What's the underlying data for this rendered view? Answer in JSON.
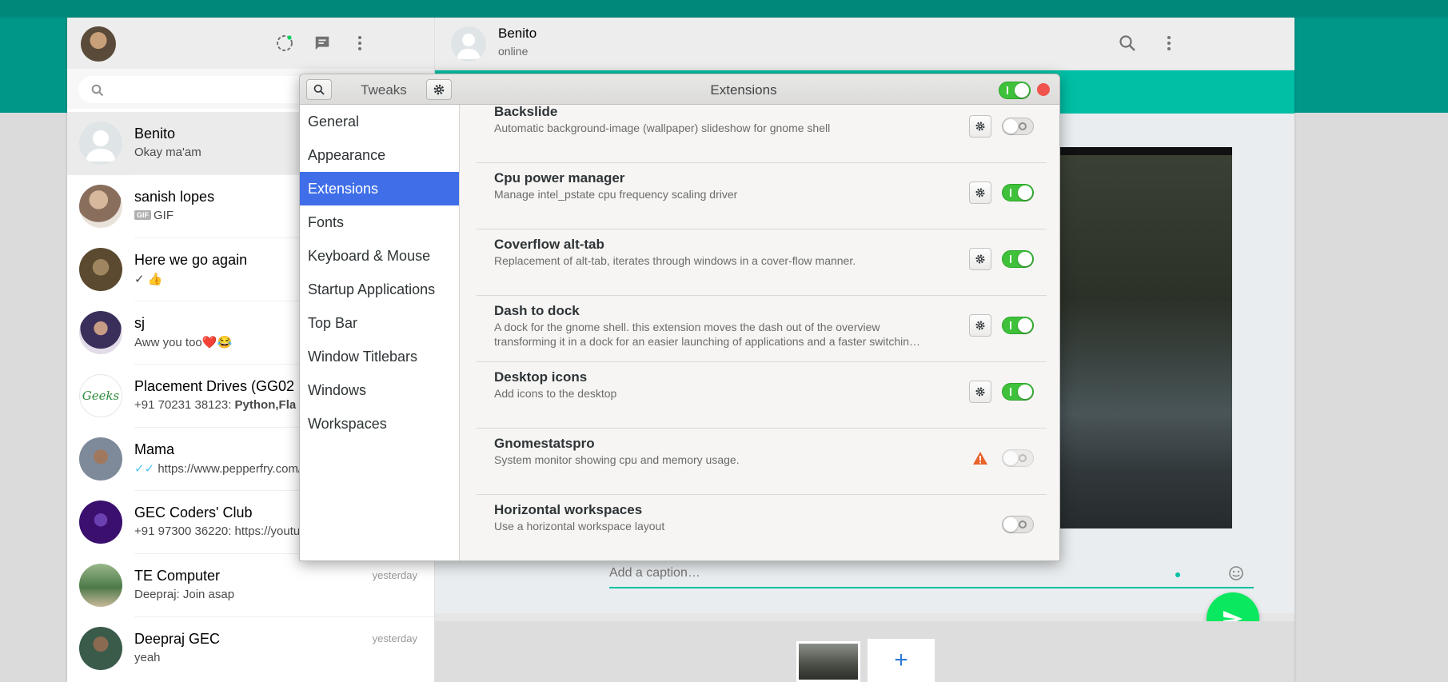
{
  "whatsapp": {
    "search": {
      "placeholder": ""
    },
    "chats": [
      {
        "name": "Benito",
        "message": "Okay ma'am",
        "time": "",
        "avatar_color": "#dfe5e7"
      },
      {
        "name": "sanish lopes",
        "gif_badge": "GIF",
        "message": "GIF",
        "time": "",
        "avatar_color": "#8a6e5c"
      },
      {
        "name": "Here we go again",
        "message": "✓ 👍",
        "time": "",
        "avatar_color": "#6b5a3e"
      },
      {
        "name": "sj",
        "message": "Aww you too❤️😂",
        "time": "",
        "avatar_color": "#3a2f5a"
      },
      {
        "name": "Placement Drives (GG02",
        "message_prefix": "+91 70231 38123: ",
        "message_bold": "Python,Fla",
        "time": "",
        "avatar_color": "#ffffff"
      },
      {
        "name": "Mama",
        "message": "https://www.pepperfry.com/",
        "time": "",
        "avatar_color": "#7e8a9a"
      },
      {
        "name": "GEC Coders' Club",
        "message": "+91 97300 36220: https://youtu",
        "time": "",
        "avatar_color": "#3a0f6e"
      },
      {
        "name": "TE Computer",
        "message": "Deepraj: Join asap",
        "time": "yesterday",
        "avatar_color": "#4d7a4a"
      },
      {
        "name": "Deepraj GEC",
        "message": "yeah",
        "time": "yesterday",
        "avatar_color": "#3a5a4a"
      }
    ],
    "contact": {
      "name": "Benito",
      "status": "online"
    },
    "caption": {
      "placeholder": "Add a caption…"
    },
    "add_media_label": "+"
  },
  "tweaks": {
    "search_title": "Tweaks",
    "page_title": "Extensions",
    "extensions_enabled": true,
    "sidebar": [
      "General",
      "Appearance",
      "Extensions",
      "Fonts",
      "Keyboard & Mouse",
      "Startup Applications",
      "Top Bar",
      "Window Titlebars",
      "Windows",
      "Workspaces"
    ],
    "selected_sidebar": "Extensions",
    "extensions": [
      {
        "name": "Backslide",
        "desc": "Automatic background-image (wallpaper) slideshow for gnome shell",
        "has_settings": true,
        "state": "off"
      },
      {
        "name": "Cpu power manager",
        "desc": "Manage intel_pstate cpu frequency scaling driver",
        "has_settings": true,
        "state": "on"
      },
      {
        "name": "Coverflow alt-tab",
        "desc": "Replacement of alt-tab, iterates through windows in a cover-flow manner.",
        "has_settings": true,
        "state": "on"
      },
      {
        "name": "Dash to dock",
        "desc": "A dock for the gnome shell. this extension moves the dash out of the overview",
        "desc2": "transforming it in a dock for an easier launching of applications and a faster switchin…",
        "has_settings": true,
        "state": "on"
      },
      {
        "name": "Desktop icons",
        "desc": "Add icons to the desktop",
        "has_settings": true,
        "state": "on"
      },
      {
        "name": "Gnomestatspro",
        "desc": "System monitor showing cpu and memory usage.",
        "has_settings": false,
        "warning": true,
        "state": "disabled"
      },
      {
        "name": "Horizontal workspaces",
        "desc": "Use a horizontal workspace layout",
        "has_settings": false,
        "state": "off"
      }
    ]
  },
  "colors": {
    "teal_dark": "#00897b",
    "teal": "#009688",
    "accent_strip": "#00bfa5",
    "send_green": "#09e85e",
    "sidebar_selected": "#3f6ee8",
    "toggle_on": "#3fc13b",
    "close_red": "#f0544c",
    "warning_orange": "#e8622a"
  }
}
